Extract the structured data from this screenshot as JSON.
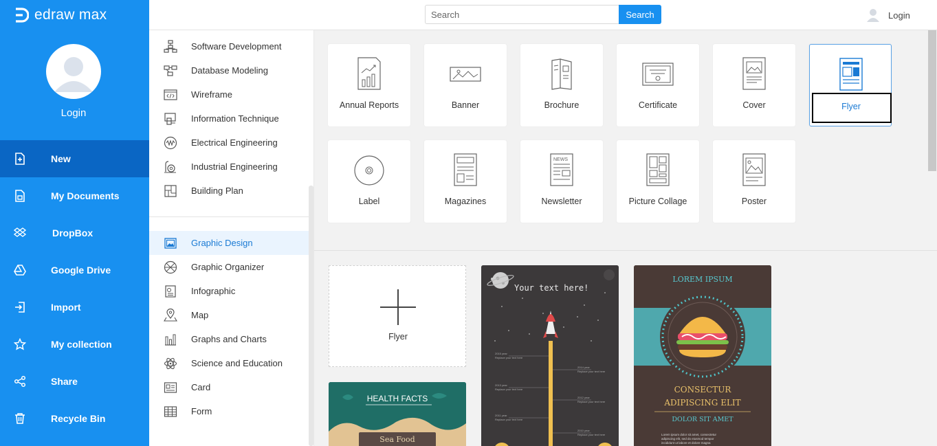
{
  "app": {
    "name": "edraw max"
  },
  "sidebar": {
    "login_label": "Login",
    "items": [
      {
        "label": "New",
        "icon": "plus-square-icon",
        "active": true
      },
      {
        "label": "My Documents",
        "icon": "document-icon",
        "active": false
      },
      {
        "label": "DropBox",
        "icon": "dropbox-icon",
        "active": false
      },
      {
        "label": "Google Drive",
        "icon": "google-drive-icon",
        "active": false
      },
      {
        "label": "Import",
        "icon": "import-icon",
        "active": false
      },
      {
        "label": "My collection",
        "icon": "star-icon",
        "active": false
      },
      {
        "label": "Share",
        "icon": "share-icon",
        "active": false
      },
      {
        "label": "Recycle Bin",
        "icon": "trash-icon",
        "active": false
      }
    ]
  },
  "header": {
    "search_placeholder": "Search",
    "search_button": "Search",
    "login_label": "Login"
  },
  "categories": {
    "items": [
      {
        "label": "Software Development",
        "icon": "software-development-icon"
      },
      {
        "label": "Database Modeling",
        "icon": "database-modeling-icon"
      },
      {
        "label": "Wireframe",
        "icon": "wireframe-icon"
      },
      {
        "label": "Information Technique",
        "icon": "information-technique-icon"
      },
      {
        "label": "Electrical Engineering",
        "icon": "electrical-engineering-icon"
      },
      {
        "label": "Industrial Engineering",
        "icon": "industrial-engineering-icon"
      },
      {
        "label": "Building Plan",
        "icon": "building-plan-icon"
      },
      {
        "label": "Graphic Design",
        "icon": "graphic-design-icon",
        "active": true
      },
      {
        "label": "Graphic Organizer",
        "icon": "graphic-organizer-icon"
      },
      {
        "label": "Infographic",
        "icon": "infographic-icon"
      },
      {
        "label": "Map",
        "icon": "map-icon"
      },
      {
        "label": "Graphs and Charts",
        "icon": "graphs-charts-icon"
      },
      {
        "label": "Science and Education",
        "icon": "science-education-icon"
      },
      {
        "label": "Card",
        "icon": "card-icon"
      },
      {
        "label": "Form",
        "icon": "form-icon"
      }
    ]
  },
  "templates": {
    "items": [
      {
        "label": "Annual Reports",
        "icon": "annual-reports-icon"
      },
      {
        "label": "Banner",
        "icon": "banner-icon"
      },
      {
        "label": "Brochure",
        "icon": "brochure-icon"
      },
      {
        "label": "Certificate",
        "icon": "certificate-icon"
      },
      {
        "label": "Cover",
        "icon": "cover-icon"
      },
      {
        "label": "Flyer",
        "icon": "flyer-icon",
        "selected": true
      },
      {
        "label": "Label",
        "icon": "label-icon"
      },
      {
        "label": "Magazines",
        "icon": "magazines-icon"
      },
      {
        "label": "Newsletter",
        "icon": "newsletter-icon"
      },
      {
        "label": "Picture Collage",
        "icon": "picture-collage-icon"
      },
      {
        "label": "Poster",
        "icon": "poster-icon"
      }
    ]
  },
  "examples": {
    "new_label": "Flyer",
    "rocket": {
      "title": "Your text here!",
      "timeline": [
        "2016 year",
        "2015 year",
        "2014 year",
        "2013 year",
        "2012 year",
        "2011 year",
        "2010 year"
      ],
      "caption": "Replace your text here"
    },
    "burger": {
      "title": "LOREM IPSUM",
      "subtitle1": "CONSECTUR",
      "subtitle2": "ADIPISCING ELIT",
      "subtitle3": "DOLOR SIT AMET",
      "body": "Lorem ipsum dolor sit amet, consectetur"
    },
    "health": {
      "title": "HEALTH FACTS",
      "button": "Sea Food"
    }
  },
  "colors": {
    "primary": "#1890f0",
    "active_nav": "#0a66c4",
    "category_active_bg": "#eaf4fe",
    "category_active_text": "#1a7ad4"
  }
}
